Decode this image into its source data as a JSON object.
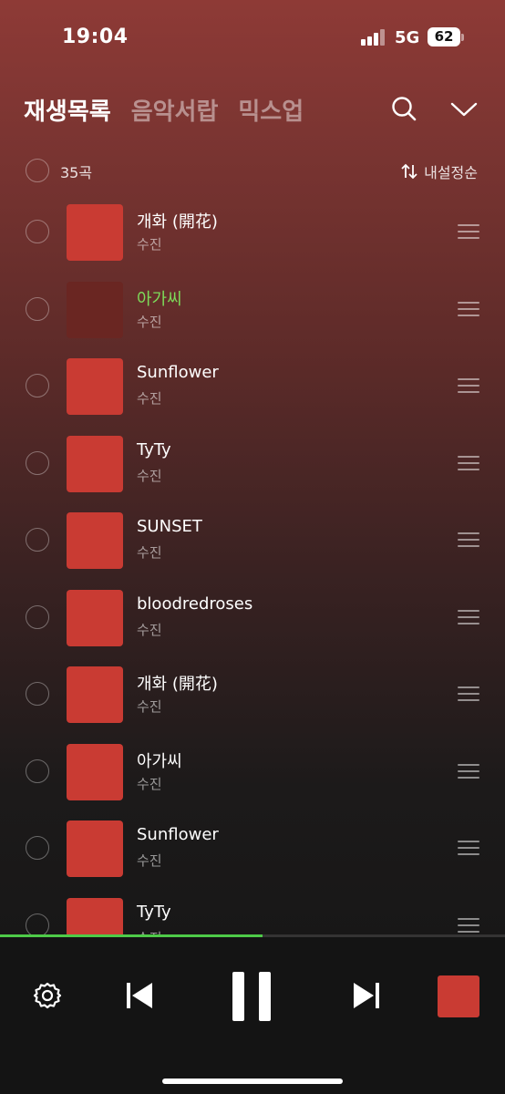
{
  "status": {
    "time": "19:04",
    "network": "5G",
    "battery": "62"
  },
  "tabs": [
    {
      "label": "재생목록",
      "active": true
    },
    {
      "label": "음악서랍",
      "active": false
    },
    {
      "label": "믹스업",
      "active": false
    }
  ],
  "icons": {
    "search": "search-icon",
    "collapse": "chevron-down-icon",
    "sort": "sort-arrows-icon",
    "settings": "gear-icon",
    "prev": "skip-previous-icon",
    "pause": "pause-icon",
    "next": "skip-next-icon",
    "drag": "drag-handle-icon"
  },
  "list": {
    "count": "35곡",
    "sort_label": "내설정순"
  },
  "tracks": [
    {
      "title": "개화 (開花)",
      "artist": "수진",
      "playing": false
    },
    {
      "title": "아가씨",
      "artist": "수진",
      "playing": true
    },
    {
      "title": "Sunflower",
      "artist": "수진",
      "playing": false
    },
    {
      "title": "TyTy",
      "artist": "수진",
      "playing": false
    },
    {
      "title": "SUNSET",
      "artist": "수진",
      "playing": false
    },
    {
      "title": "bloodredroses",
      "artist": "수진",
      "playing": false
    },
    {
      "title": "개화 (開花)",
      "artist": "수진",
      "playing": false
    },
    {
      "title": "아가씨",
      "artist": "수진",
      "playing": false
    },
    {
      "title": "Sunflower",
      "artist": "수진",
      "playing": false
    },
    {
      "title": "TyTy",
      "artist": "수진",
      "playing": false
    }
  ],
  "player": {
    "progress": 0.52
  },
  "colors": {
    "accent": "#4ecb48",
    "playing_title": "#7ddc5a",
    "cover_red": "#c93b33"
  }
}
